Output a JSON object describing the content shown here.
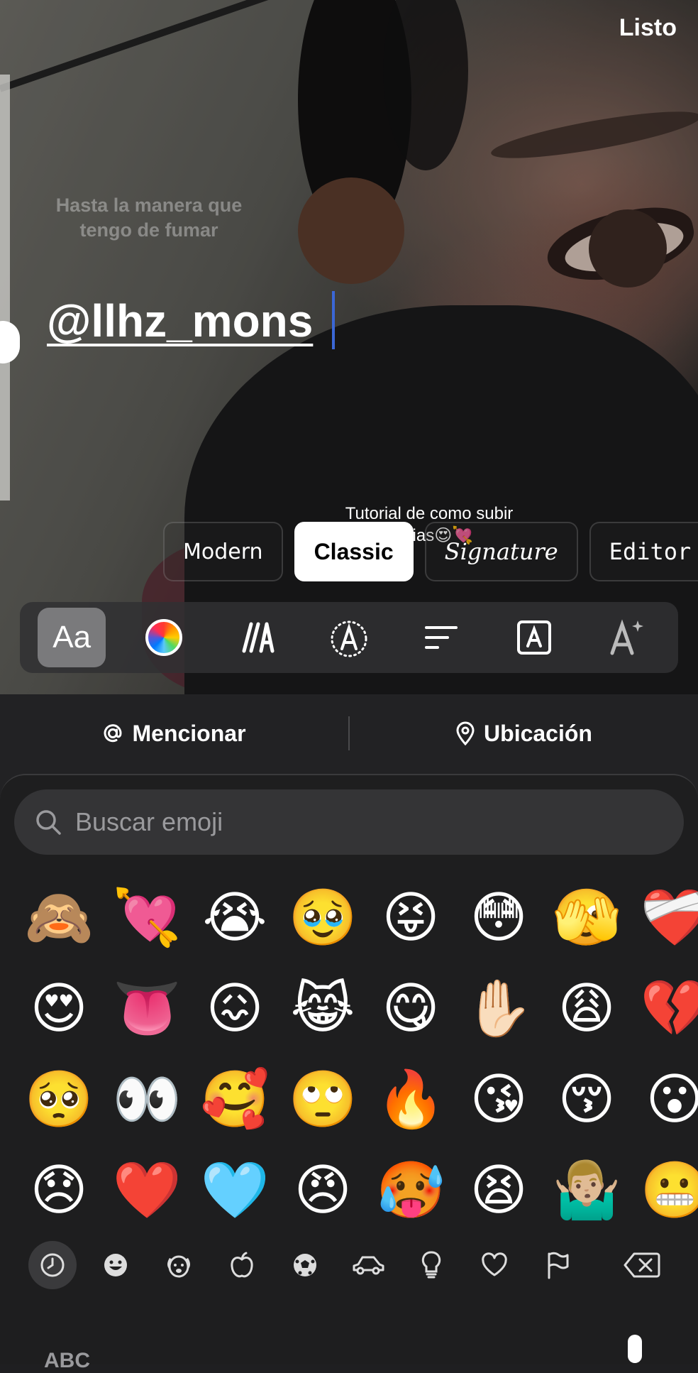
{
  "header": {
    "done_label": "Listo"
  },
  "canvas": {
    "ghost_text": "Hasta la manera que tengo de fumar",
    "mention_text": "@llhz_mons",
    "tutorial_text": "Tutorial de como subir novias😍💘"
  },
  "font_styles": [
    {
      "label": "Modern"
    },
    {
      "label": "Classic",
      "selected": true
    },
    {
      "label": "Signature"
    },
    {
      "label": "Editor"
    }
  ],
  "text_tools": [
    {
      "icon": "font-size-icon",
      "label": "Aa",
      "selected": true
    },
    {
      "icon": "color-wheel-icon"
    },
    {
      "icon": "italic-slash-icon"
    },
    {
      "icon": "text-effect-icon"
    },
    {
      "icon": "align-icon"
    },
    {
      "icon": "text-background-icon"
    },
    {
      "icon": "text-animation-icon"
    }
  ],
  "actions": {
    "mention_label": "Mencionar",
    "location_label": "Ubicación"
  },
  "emoji_keyboard": {
    "search_placeholder": "Buscar emoji",
    "emojis": [
      "🙈",
      "💘",
      "😭",
      "🥹",
      "😝",
      "😳",
      "🫣",
      "❤️‍🩹",
      "😍",
      "👅",
      "😖",
      "😹",
      "😋",
      "✋🏻",
      "😩",
      "💔",
      "🥺",
      "👀",
      "🥰",
      "🙄",
      "🔥",
      "😘",
      "😚",
      "😮",
      "😞",
      "❤️",
      "🩵",
      "😠",
      "🥵",
      "😫",
      "🤷🏼‍♂️",
      "😬"
    ],
    "categories": [
      "recent",
      "smileys",
      "animals",
      "food",
      "activity",
      "travel",
      "objects",
      "symbols",
      "flags"
    ],
    "abc_label": "ABC"
  },
  "colors": {
    "accent_caret": "#3b67d6",
    "keyboard_bg": "#1e1e1f"
  }
}
